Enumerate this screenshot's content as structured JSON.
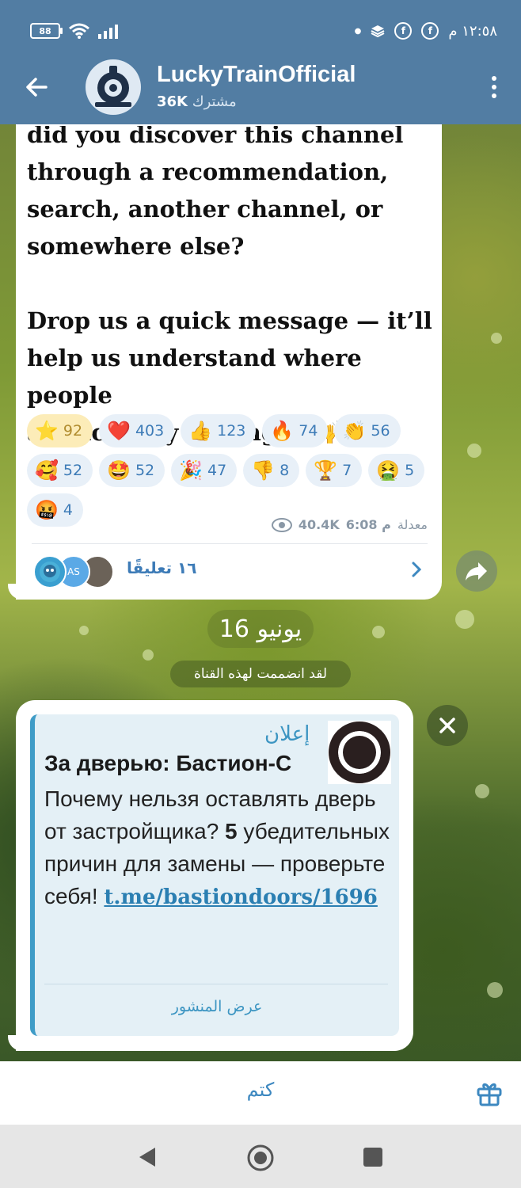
{
  "status_bar": {
    "battery": "88",
    "time": "١٢:٥٨ م"
  },
  "header": {
    "title": "LuckyTrainOfficial",
    "subscribers_count": "36K",
    "subscribers_label": "مشترك"
  },
  "post": {
    "text_lines": [
      "did you discover this channel",
      "through a recommendation,",
      "search, another channel, or",
      "somewhere else?",
      "",
      "Drop us a quick message — it’ll",
      "help us understand where people",
      "are actually finding us 🙌"
    ],
    "reactions": [
      {
        "emoji": "⭐",
        "count": "92",
        "active": true
      },
      {
        "emoji": "❤️",
        "count": "403"
      },
      {
        "emoji": "👍",
        "count": "123"
      },
      {
        "emoji": "🔥",
        "count": "74"
      },
      {
        "emoji": "👏",
        "count": "56"
      },
      {
        "emoji": "🥰",
        "count": "52"
      },
      {
        "emoji": "🤩",
        "count": "52"
      },
      {
        "emoji": "🎉",
        "count": "47"
      },
      {
        "emoji": "👎",
        "count": "8"
      },
      {
        "emoji": "🏆",
        "count": "7"
      },
      {
        "emoji": "🤮",
        "count": "5"
      },
      {
        "emoji": "🤬",
        "count": "4"
      }
    ],
    "views": "40.4K",
    "edited_label": "معدلة",
    "time": "6:08 م",
    "comments_label": "١٦ تعليقًا",
    "comment_avatar_initials": "AS"
  },
  "date_label": "16 يونيو",
  "service_message": "لقد انضممت لهذه القناة",
  "ad": {
    "tag": "إعلان",
    "title": "За дверью: Бастион-С",
    "body_1": "Почему нельзя оставлять дверь от застройщика? ",
    "body_bold": "5",
    "body_2": " убедительных причин для замены — проверьте себя! ",
    "link": "t.me/bastiondoors/1696",
    "view_post": "عرض المنشور"
  },
  "bottom_bar": {
    "mute_label": "كتم"
  },
  "colors": {
    "header": "#527da3",
    "accent": "#3d88c0",
    "active_reaction_bg": "#fcecb8"
  }
}
